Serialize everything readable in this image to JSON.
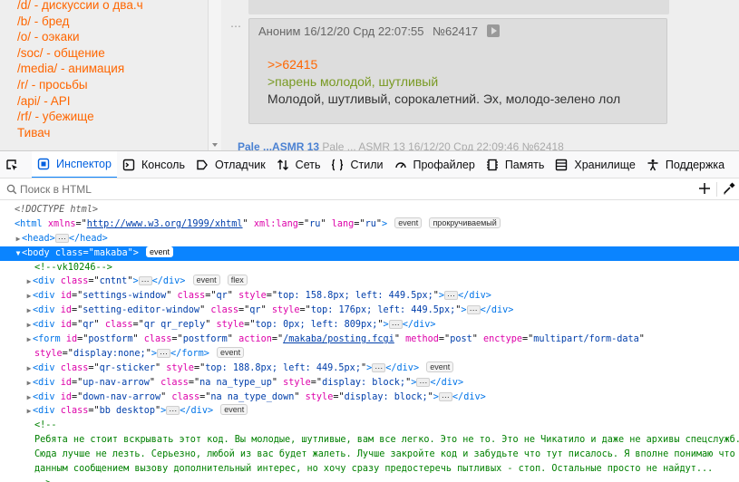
{
  "sidebar": {
    "boards": [
      "/d/ - дискуссии о два.ч",
      "/b/ - бред",
      "/o/ - оэкаки",
      "/soc/ - общение",
      "/media/ - анимация",
      "/r/ - просьбы",
      "/api/ - API",
      "/rf/ - убежище",
      "Тивач"
    ]
  },
  "post": {
    "author": "Аноним",
    "date": "16/12/20 Срд 22:07:55",
    "number": "№62417",
    "reply_link": ">>62415",
    "greentext": ">парень молодой, шутливый",
    "text": "Молодой, шутливый, сорокалетний. Эх, молодо-зелено лол",
    "dots": "⋯"
  },
  "next_post": {
    "name": "Pale ...ASMR 13",
    "meta": "Pale ... ASMR 13 16/12/20 Срд 22:09:46 №62418"
  },
  "devtools": {
    "tabs": [
      {
        "label": "Инспектор",
        "icon": "inspector-icon",
        "active": true
      },
      {
        "label": "Консоль",
        "icon": "console-icon",
        "active": false
      },
      {
        "label": "Отладчик",
        "icon": "debugger-icon",
        "active": false
      },
      {
        "label": "Сеть",
        "icon": "network-icon",
        "active": false
      },
      {
        "label": "Стили",
        "icon": "style-editor-icon",
        "active": false
      },
      {
        "label": "Профайлер",
        "icon": "performance-icon",
        "active": false
      },
      {
        "label": "Память",
        "icon": "memory-icon",
        "active": false
      },
      {
        "label": "Хранилище",
        "icon": "storage-icon",
        "active": false
      },
      {
        "label": "Поддержка",
        "icon": "accessibility-icon",
        "active": false
      }
    ],
    "search_placeholder": "Поиск в HTML",
    "accent_color": "#0a84ff"
  },
  "tree": {
    "doctype": "<!DOCTYPE html>",
    "html_open": {
      "tag": "html",
      "attrs": [
        [
          "xmlns",
          "http://www.w3.org/1999/xhtml"
        ],
        [
          "xml:lang",
          "ru"
        ],
        [
          "lang",
          "ru"
        ]
      ],
      "badges": [
        "event",
        "прокручиваемый"
      ]
    },
    "head": {
      "open": "<head>",
      "close": "</head>"
    },
    "body": {
      "tag": "body",
      "attrs": [
        [
          "class",
          "makaba"
        ]
      ],
      "badges": [
        "event"
      ]
    },
    "comment_vk": "<!--vk10246-->",
    "children": [
      {
        "tag": "div",
        "attrs": [
          [
            "class",
            "cntnt"
          ]
        ],
        "badges": [
          "event",
          "flex"
        ]
      },
      {
        "tag": "div",
        "attrs": [
          [
            "id",
            "settings-window"
          ],
          [
            "class",
            "qr"
          ],
          [
            "style",
            "top: 158.8px; left: 449.5px;"
          ]
        ],
        "badges": []
      },
      {
        "tag": "div",
        "attrs": [
          [
            "id",
            "setting-editor-window"
          ],
          [
            "class",
            "qr"
          ],
          [
            "style",
            "top: 176px; left: 449.5px;"
          ]
        ],
        "badges": []
      },
      {
        "tag": "div",
        "attrs": [
          [
            "id",
            "qr"
          ],
          [
            "class",
            "qr qr_reply"
          ],
          [
            "style",
            "top: 0px; left: 809px;"
          ]
        ],
        "badges": []
      }
    ],
    "form": {
      "line1_attrs": [
        [
          "id",
          "postform"
        ],
        [
          "class",
          "postform"
        ],
        [
          "action",
          "/makaba/posting.fcgi"
        ],
        [
          "method",
          "post"
        ],
        [
          "enctype",
          "multipart/form-data"
        ]
      ],
      "line2_attrs": [
        [
          "style",
          "display:none;"
        ]
      ],
      "badges": [
        "event"
      ]
    },
    "children2": [
      {
        "tag": "div",
        "attrs": [
          [
            "class",
            "qr-sticker"
          ],
          [
            "style",
            "top: 188.8px; left: 449.5px;"
          ]
        ],
        "badges": [
          "event"
        ]
      },
      {
        "tag": "div",
        "attrs": [
          [
            "id",
            "up-nav-arrow"
          ],
          [
            "class",
            "na na_type_up"
          ],
          [
            "style",
            "display: block;"
          ]
        ],
        "badges": []
      },
      {
        "tag": "div",
        "attrs": [
          [
            "id",
            "down-nav-arrow"
          ],
          [
            "class",
            "na na_type_down"
          ],
          [
            "style",
            "display: block;"
          ]
        ],
        "badges": []
      },
      {
        "tag": "div",
        "attrs": [
          [
            "class",
            "bb desktop"
          ]
        ],
        "badges": [
          "event"
        ]
      }
    ],
    "bottom_comment": [
      "<!--",
      "Ребята не стоит вскрывать этот код. Вы молодые, шутливые, вам все легко. Это не то. Это не Чикатило и даже не архивы спецслужб.",
      "Сюда лучше не лезть. Серьезно, любой из вас будет жалеть. Лучше закройте код и забудьте что тут писалось. Я вполне понимаю что",
      "данным сообщением вызову дополнительный интерес, но хочу сразу предостеречь пытливых - стоп. Остальные просто не найдут...",
      "-->"
    ]
  }
}
